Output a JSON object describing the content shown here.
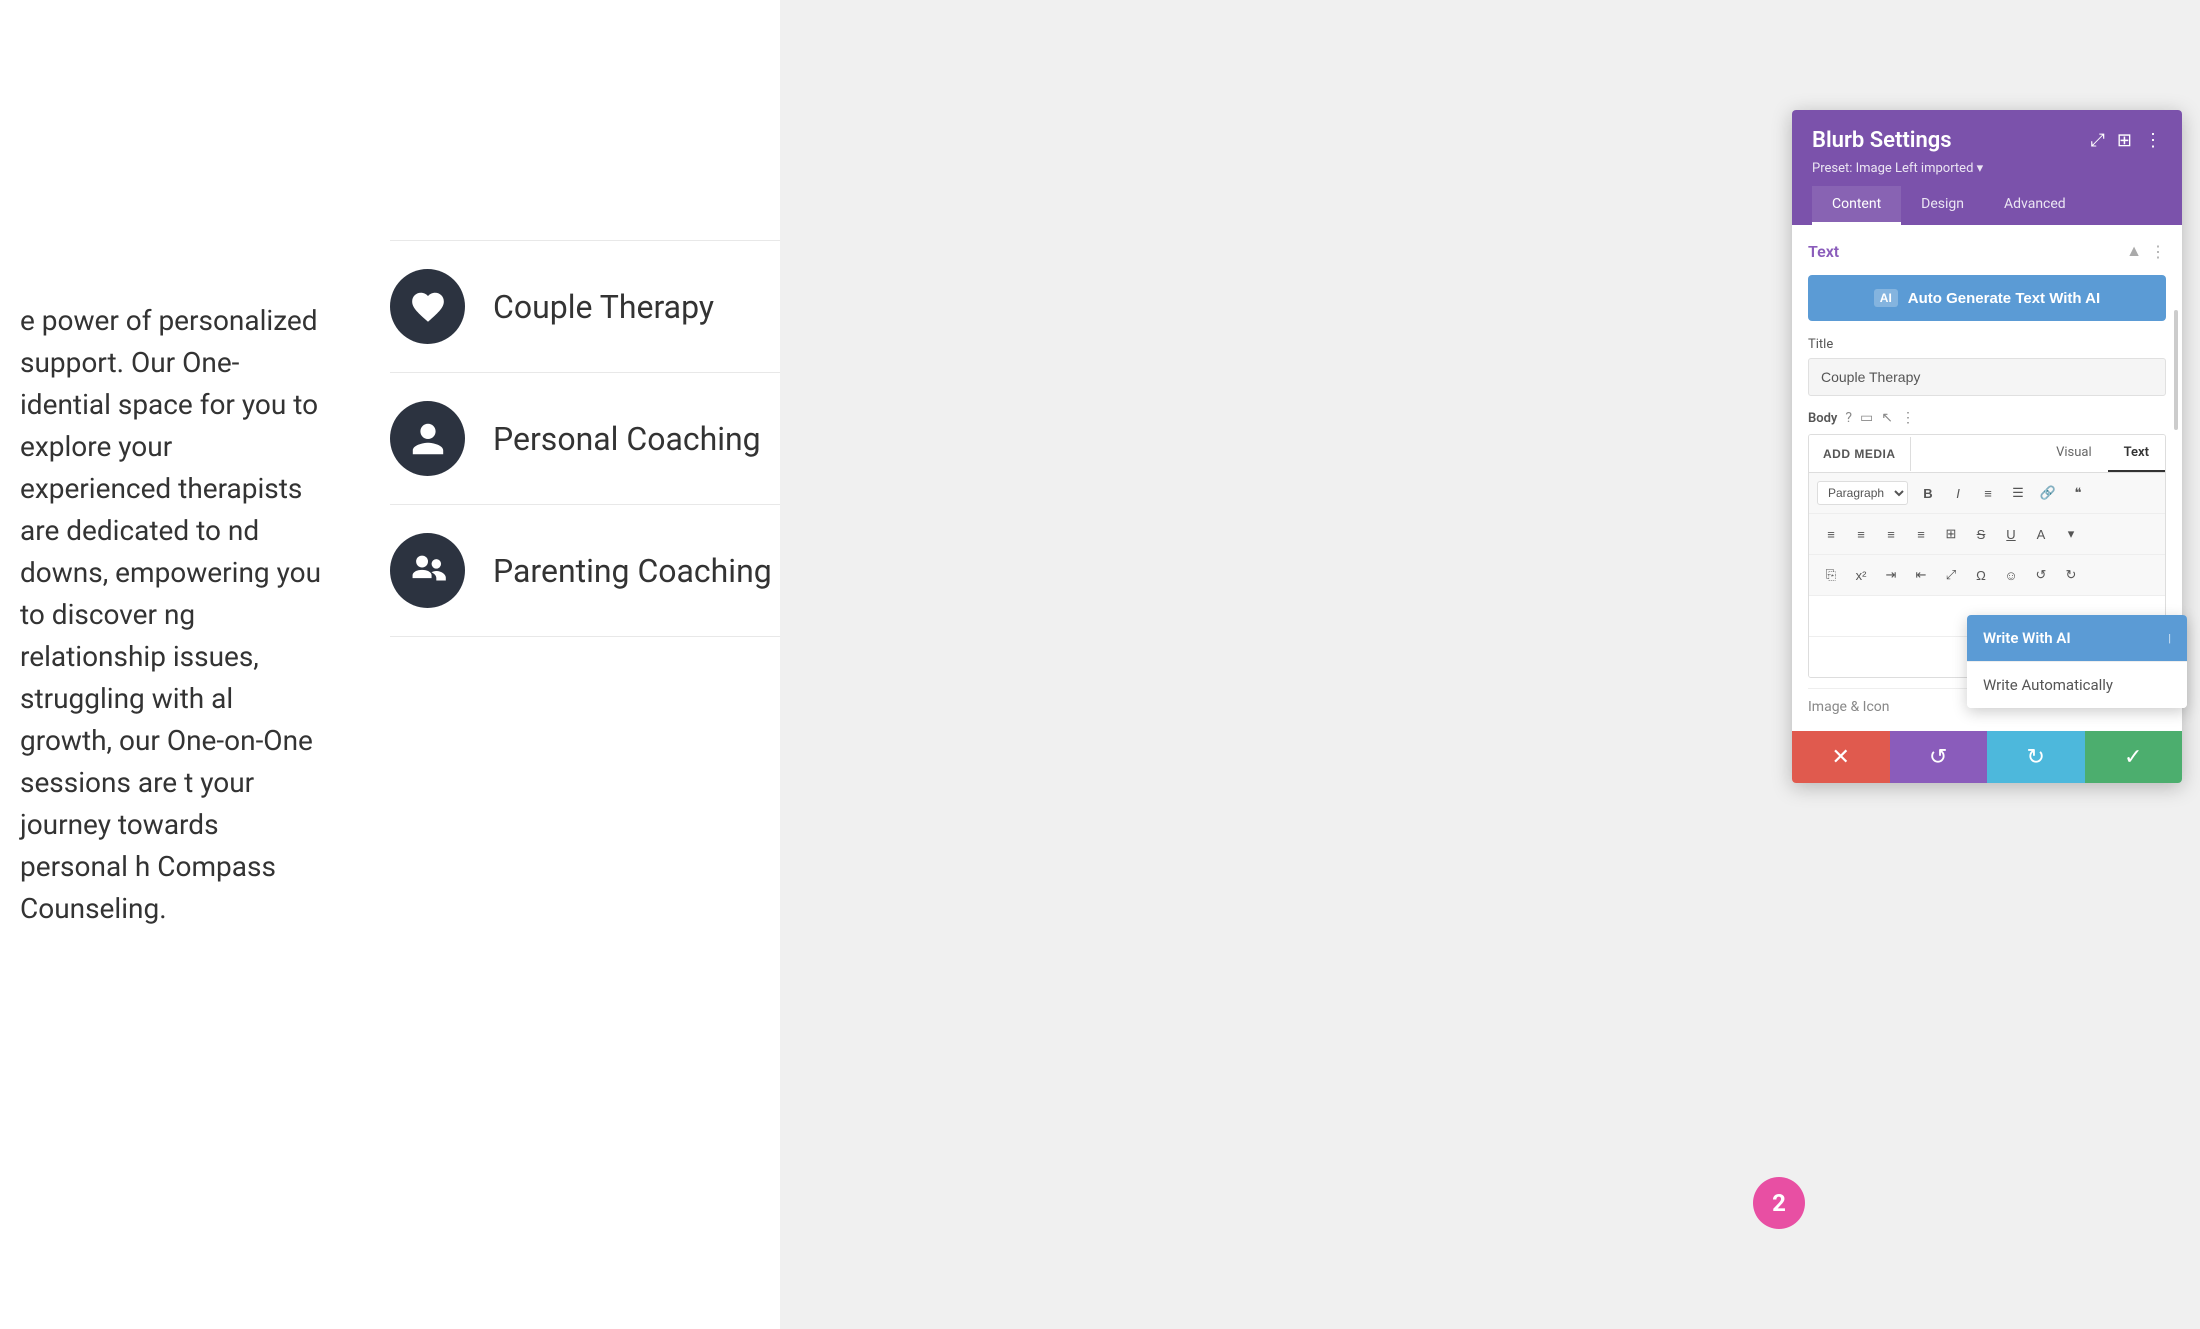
{
  "page": {
    "background_color": "#f0f0f0"
  },
  "left_panel": {
    "body_text": "e power of personalized support. Our One-\nidential space for you to explore your\nexperienced therapists are dedicated to\nnd downs, empowering you to discover\nng relationship issues, struggling with\nal growth, our One-on-One sessions are\nt your journey towards personal\nh Compass Counseling."
  },
  "services": [
    {
      "label": "Couple Therapy",
      "icon": "heart"
    },
    {
      "label": "Personal Coaching",
      "icon": "person"
    },
    {
      "label": "Parenting Coaching",
      "icon": "people"
    }
  ],
  "settings_panel": {
    "title": "Blurb Settings",
    "preset": "Preset: Image Left imported ▾",
    "tabs": [
      "Content",
      "Design",
      "Advanced"
    ],
    "active_tab": "Content",
    "icons": {
      "expand": "⤢",
      "layout": "⊞",
      "more": "⋮"
    }
  },
  "text_section": {
    "title": "Text",
    "ai_button_label": "Auto Generate Text With AI",
    "ai_badge": "AI",
    "title_field_label": "Title",
    "title_field_value": "Couple Therapy",
    "body_label": "Body",
    "add_media_btn": "ADD MEDIA",
    "view_tabs": [
      "Visual",
      "Text"
    ],
    "active_view_tab": "Text",
    "paragraph_select": "Paragraph",
    "ai_icon_label": "AI",
    "image_icon_label": "Image & Icon"
  },
  "write_ai_dropdown": {
    "primary_option": "Write With AI",
    "secondary_option": "Write Automatically",
    "badge_number": "2"
  },
  "bottom_bar": {
    "cancel_icon": "✕",
    "undo_icon": "↺",
    "redo_icon": "↻",
    "save_icon": "✓"
  }
}
